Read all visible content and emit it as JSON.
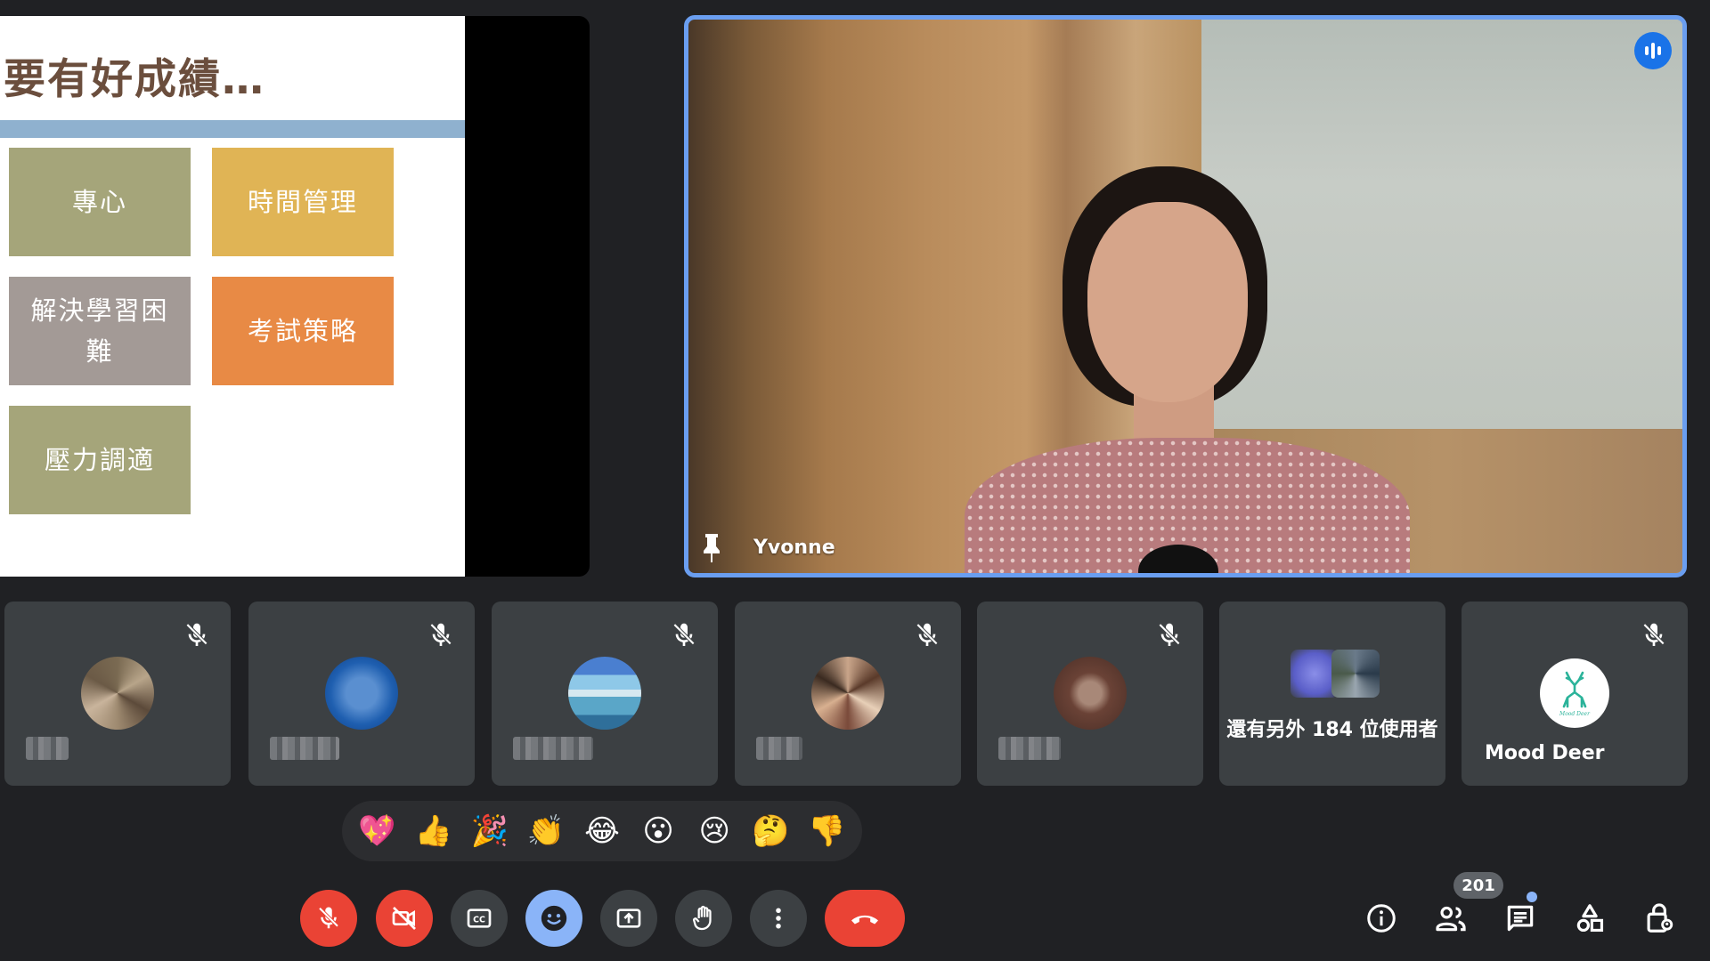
{
  "presentation": {
    "title": "要有好成績…",
    "boxes": [
      {
        "label": "專心",
        "color": "#a5a57a"
      },
      {
        "label": "時間管理",
        "color": "#e0b455"
      },
      {
        "label": "解決學習困難",
        "color": "#a39a96"
      },
      {
        "label": "考試策略",
        "color": "#e88a45"
      },
      {
        "label": "壓力調適",
        "color": "#a5a57a"
      }
    ]
  },
  "speaker": {
    "name": "Yvonne",
    "accent": "#6a9ef0"
  },
  "participants": {
    "more_label": "還有另外 184 位使用者",
    "mood_deer_name": "Mood Deer",
    "mood_deer_logo_text": "Mood Deer"
  },
  "reactions": [
    "💖",
    "👍",
    "🎉",
    "👏",
    "😂",
    "😮",
    "😢",
    "🤔",
    "👎"
  ],
  "toolbar": {
    "participant_count": "201"
  },
  "colors": {
    "background": "#202124",
    "tile": "#3c4043",
    "danger": "#ea4335",
    "active_blue": "#8ab4f8"
  }
}
